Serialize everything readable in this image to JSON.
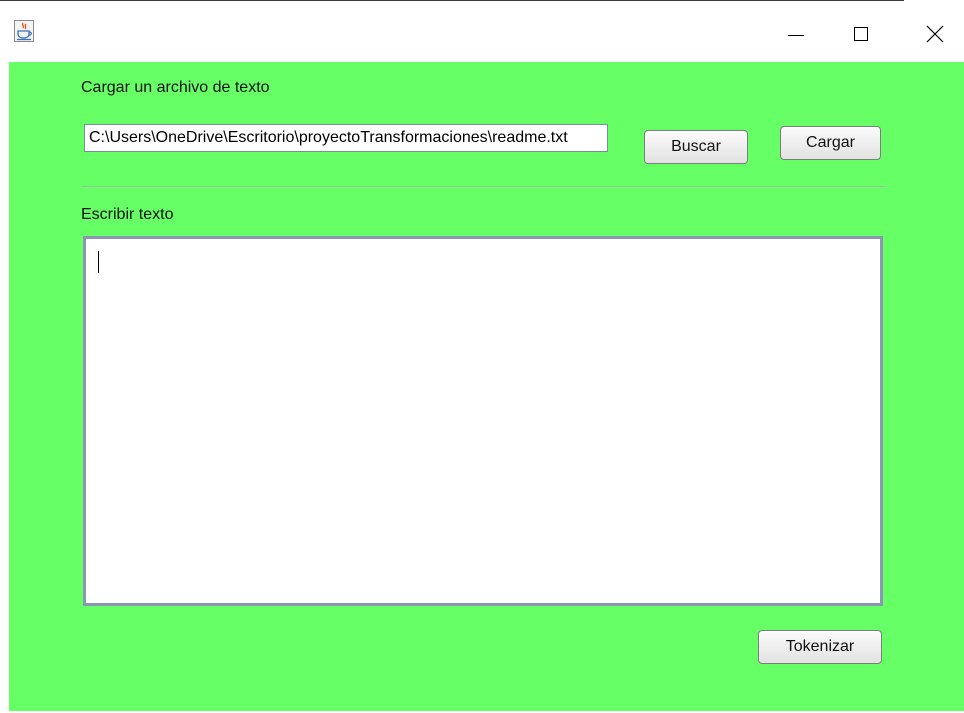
{
  "window": {
    "title": "",
    "background": "#66ff66"
  },
  "titlebar": {
    "app_icon": "java-coffee-cup-icon",
    "minimize_icon": "minimize-icon",
    "maximize_icon": "maximize-icon",
    "close_icon": "close-icon"
  },
  "file_section": {
    "label": "Cargar un archivo de texto",
    "path_value": "C:\\Users\\OneDrive\\Escritorio\\proyectoTransformaciones\\readme.txt",
    "search_button": "Buscar",
    "load_button": "Cargar"
  },
  "text_section": {
    "label": "Escribir texto",
    "text_value": ""
  },
  "actions": {
    "tokenize_button": "Tokenizar"
  }
}
